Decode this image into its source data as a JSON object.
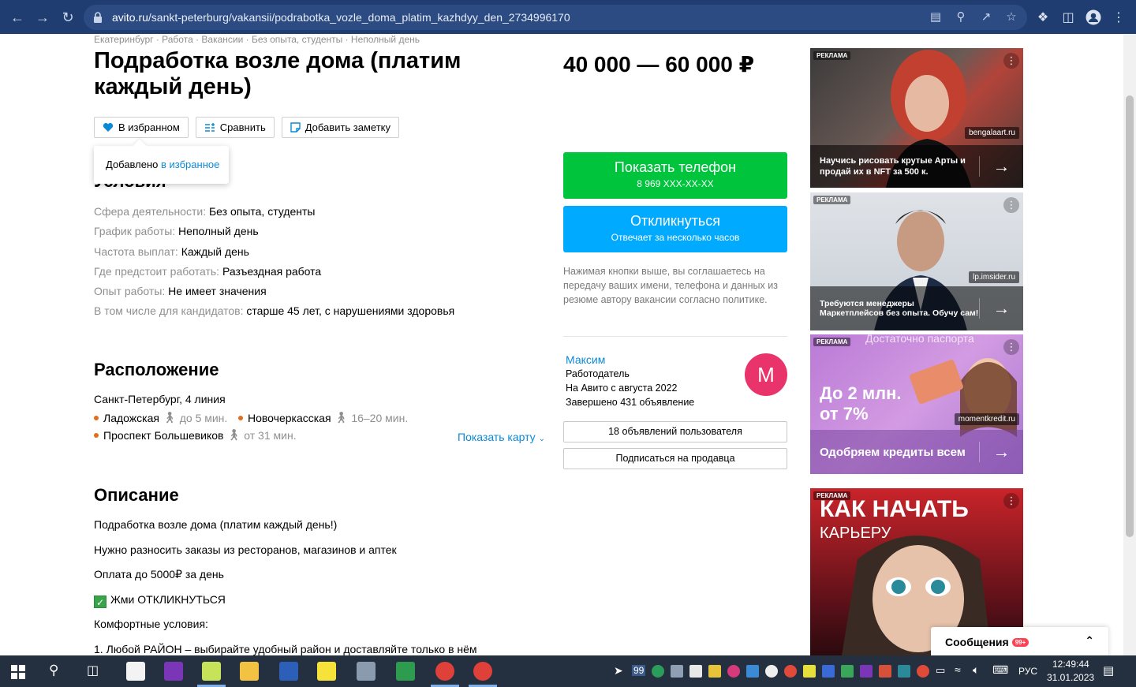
{
  "browser": {
    "url_host": "avito.ru",
    "url_path": "/sankt-peterburg/vakansii/podrabotka_vozle_doma_platim_kazhdyy_den_2734996170"
  },
  "breadcrumb": "Екатеринбург · Работа · Вакансии · Без опыта, студенты · Неполный день",
  "title": "Подработка возле дома (платим каждый день)",
  "price": "40 000 — 60 000 ₽",
  "actions": {
    "favorite": "В избранном",
    "compare": "Сравнить",
    "note": "Добавить заметку"
  },
  "tooltip": {
    "text": "Добавлено ",
    "link": "в избранное"
  },
  "conditions": {
    "heading": "Условия",
    "rows": [
      {
        "key": "Сфера деятельности:",
        "value": "Без опыта, студенты"
      },
      {
        "key": "График работы:",
        "value": "Неполный день"
      },
      {
        "key": "Частота выплат:",
        "value": "Каждый день"
      },
      {
        "key": "Где предстоит работать:",
        "value": "Разъездная работа"
      },
      {
        "key": "Опыт работы:",
        "value": "Не имеет значения"
      },
      {
        "key": "В том числе для кандидатов:",
        "value": "старше 45 лет, с нарушениями здоровья"
      }
    ]
  },
  "location": {
    "heading": "Расположение",
    "address": "Санкт-Петербург, 4 линия",
    "metro": [
      {
        "name": "Ладожская",
        "time": "до 5 мин."
      },
      {
        "name": "Новочеркасская",
        "time": "16–20 мин."
      },
      {
        "name": "Проспект Большевиков",
        "time": "от 31 мин."
      }
    ],
    "map_link": "Показать карту"
  },
  "description": {
    "heading": "Описание",
    "lines": [
      "Подработка возле дома (платим каждый день!)",
      "Нужно разносить заказы из ресторанов, магазинов и аптек",
      "Оплата до 5000₽ за день",
      "Жми ОТКЛИКНУТЬСЯ",
      "Комфортные условия:",
      "1. Любой РАЙОН – выбирайте удобный район и доставляйте только в нём"
    ]
  },
  "contact": {
    "phone_label": "Показать телефон",
    "phone_masked": "8 969 XXX-XX-XX",
    "respond_label": "Откликнуться",
    "respond_sub": "Отвечает за несколько часов",
    "disclaimer": "Нажимая кнопки выше, вы соглашаетесь на передачу ваших имени, телефона и данных из резюме автору вакансии согласно политике."
  },
  "seller": {
    "name": "Максим",
    "role": "Работодатель",
    "since": "На Авито с августа 2022",
    "completed": "Завершено 431 объявление",
    "avatar_letter": "М",
    "listings_button": "18 объявлений пользователя",
    "subscribe_button": "Подписаться на продавца"
  },
  "ads": [
    {
      "badge": "РЕКЛАМА",
      "domain": "bengalaart.ru",
      "caption": "Научись рисовать крутые Арты и продай их в NFT за 500 к."
    },
    {
      "badge": "РЕКЛАМА",
      "domain": "lp.imsider.ru",
      "caption": "Требуются менеджеры Маркетплейсов без опыта. Обучу сам!"
    },
    {
      "badge": "РЕКЛАМА",
      "domain": "momentkredit.ru",
      "headline": "До 2 млн. от 7%",
      "top_text": "Достаточно паспорта",
      "caption": "Одобряем кредиты всем"
    },
    {
      "badge": "РЕКЛАМА",
      "headline": "КАК НАЧАТЬ",
      "sub": "КАРЬЕРУ"
    }
  ],
  "messages": {
    "label": "Сообщения",
    "badge": "99+"
  },
  "taskbar": {
    "tray_badge": "99",
    "language": "РУС",
    "time": "12:49:44",
    "date": "31.01.2023"
  },
  "colors": {
    "green": "#00c43c",
    "blue": "#00aaff",
    "link": "#0a8ad6",
    "avatar": "#e8336b"
  }
}
